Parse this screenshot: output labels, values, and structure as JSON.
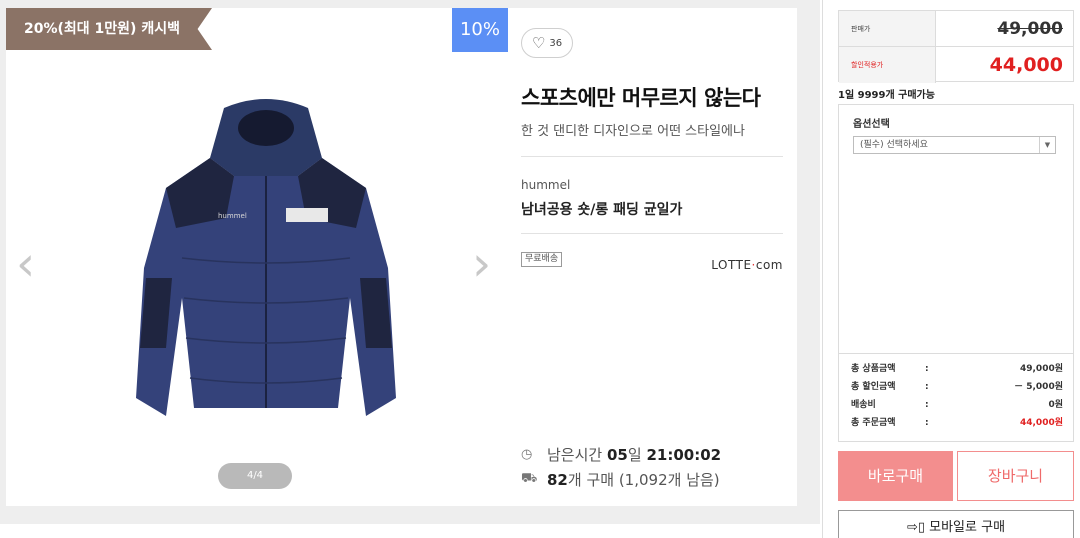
{
  "product": {
    "cashback_tag": "20%(최대 1만원) 캐시백",
    "discount_badge": "10%",
    "image_pager": "4/4",
    "like_count": "36",
    "title": "스포츠에만 머무르지 않는다",
    "subtitle": "한 것 댄디한 디자인으로 어떤 스타일에나",
    "brand": "hummel",
    "name": "남녀공용 숏/롱 패딩 균일가",
    "free_shipping": "무료배송",
    "seller_logo_left": "LOTTE",
    "seller_logo_dot": "·",
    "seller_logo_right": "com",
    "remaining_label": "남은시간",
    "remaining_days": "05",
    "remaining_days_unit": "일",
    "remaining_time": "21:00:02",
    "purchase_count": "82",
    "purchase_unit": "개 구매",
    "purchase_left": "(1,092개 남음)"
  },
  "order": {
    "price_label": "판매가",
    "original_price": "49,000",
    "sale_label": "할인적용가",
    "sale_price": "44,000",
    "daily_limit": "1일 9999개 구매가능",
    "option_title": "옵션선택",
    "option_placeholder": "(필수) 선택하세요",
    "summary": [
      {
        "label": "총 상품금액",
        "value": "49,000원"
      },
      {
        "label": "총 할인금액",
        "value": "－ 5,000원"
      },
      {
        "label": "배송비",
        "value": "0원"
      },
      {
        "label": "총 주문금액",
        "value": "44,000원"
      }
    ],
    "buy_now": "바로구매",
    "cart": "장바구니",
    "mobile_order": "모바일로 구매"
  },
  "colors": {
    "accent_red": "#e02020",
    "buy_button": "#f38e8e",
    "discount_badge": "#5b8ff5",
    "cashback_tag": "#8b7366"
  }
}
